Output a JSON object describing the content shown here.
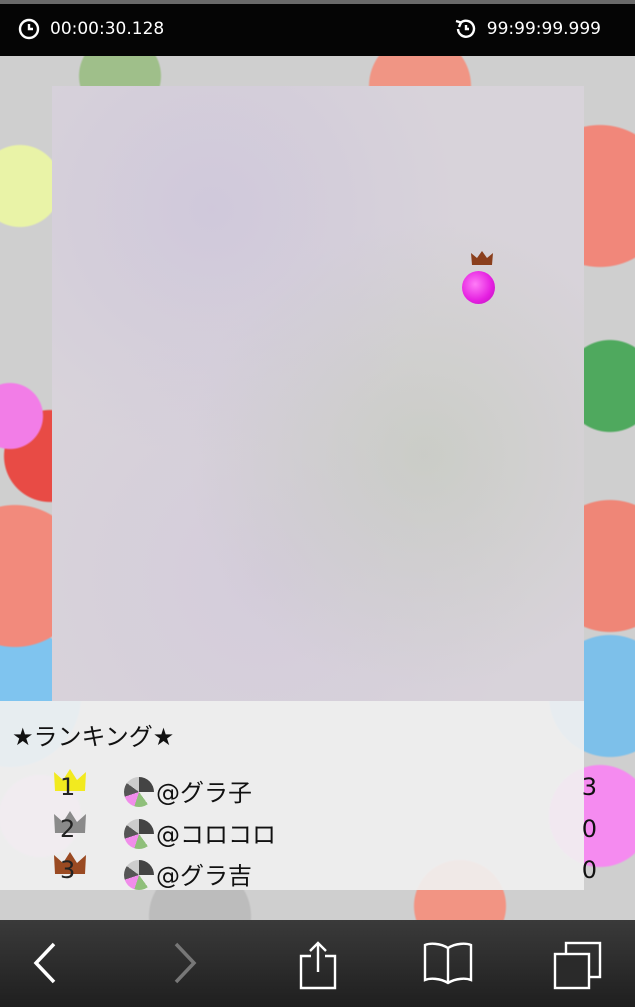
{
  "status": {
    "elapsed_time": "00:00:30.128",
    "best_time": "99:99:99.999"
  },
  "ranking": {
    "title": "★ランキング★",
    "entries": [
      {
        "rank": "1",
        "name": "@グラ子",
        "score": "3",
        "crown_color": "#f2ea1f"
      },
      {
        "rank": "2",
        "name": "@コロコロ",
        "score": "0",
        "crown_color": "#8a8a8a"
      },
      {
        "rank": "3",
        "name": "@グラ吉",
        "score": "0",
        "crown_color": "#9a4a22"
      }
    ]
  },
  "colors": {
    "player_ball": "#e41ee0",
    "player_crown": "#8b3f1d"
  },
  "toolbar": {
    "icons": [
      "back-icon",
      "forward-icon",
      "share-icon",
      "bookmarks-icon",
      "tabs-icon"
    ]
  }
}
